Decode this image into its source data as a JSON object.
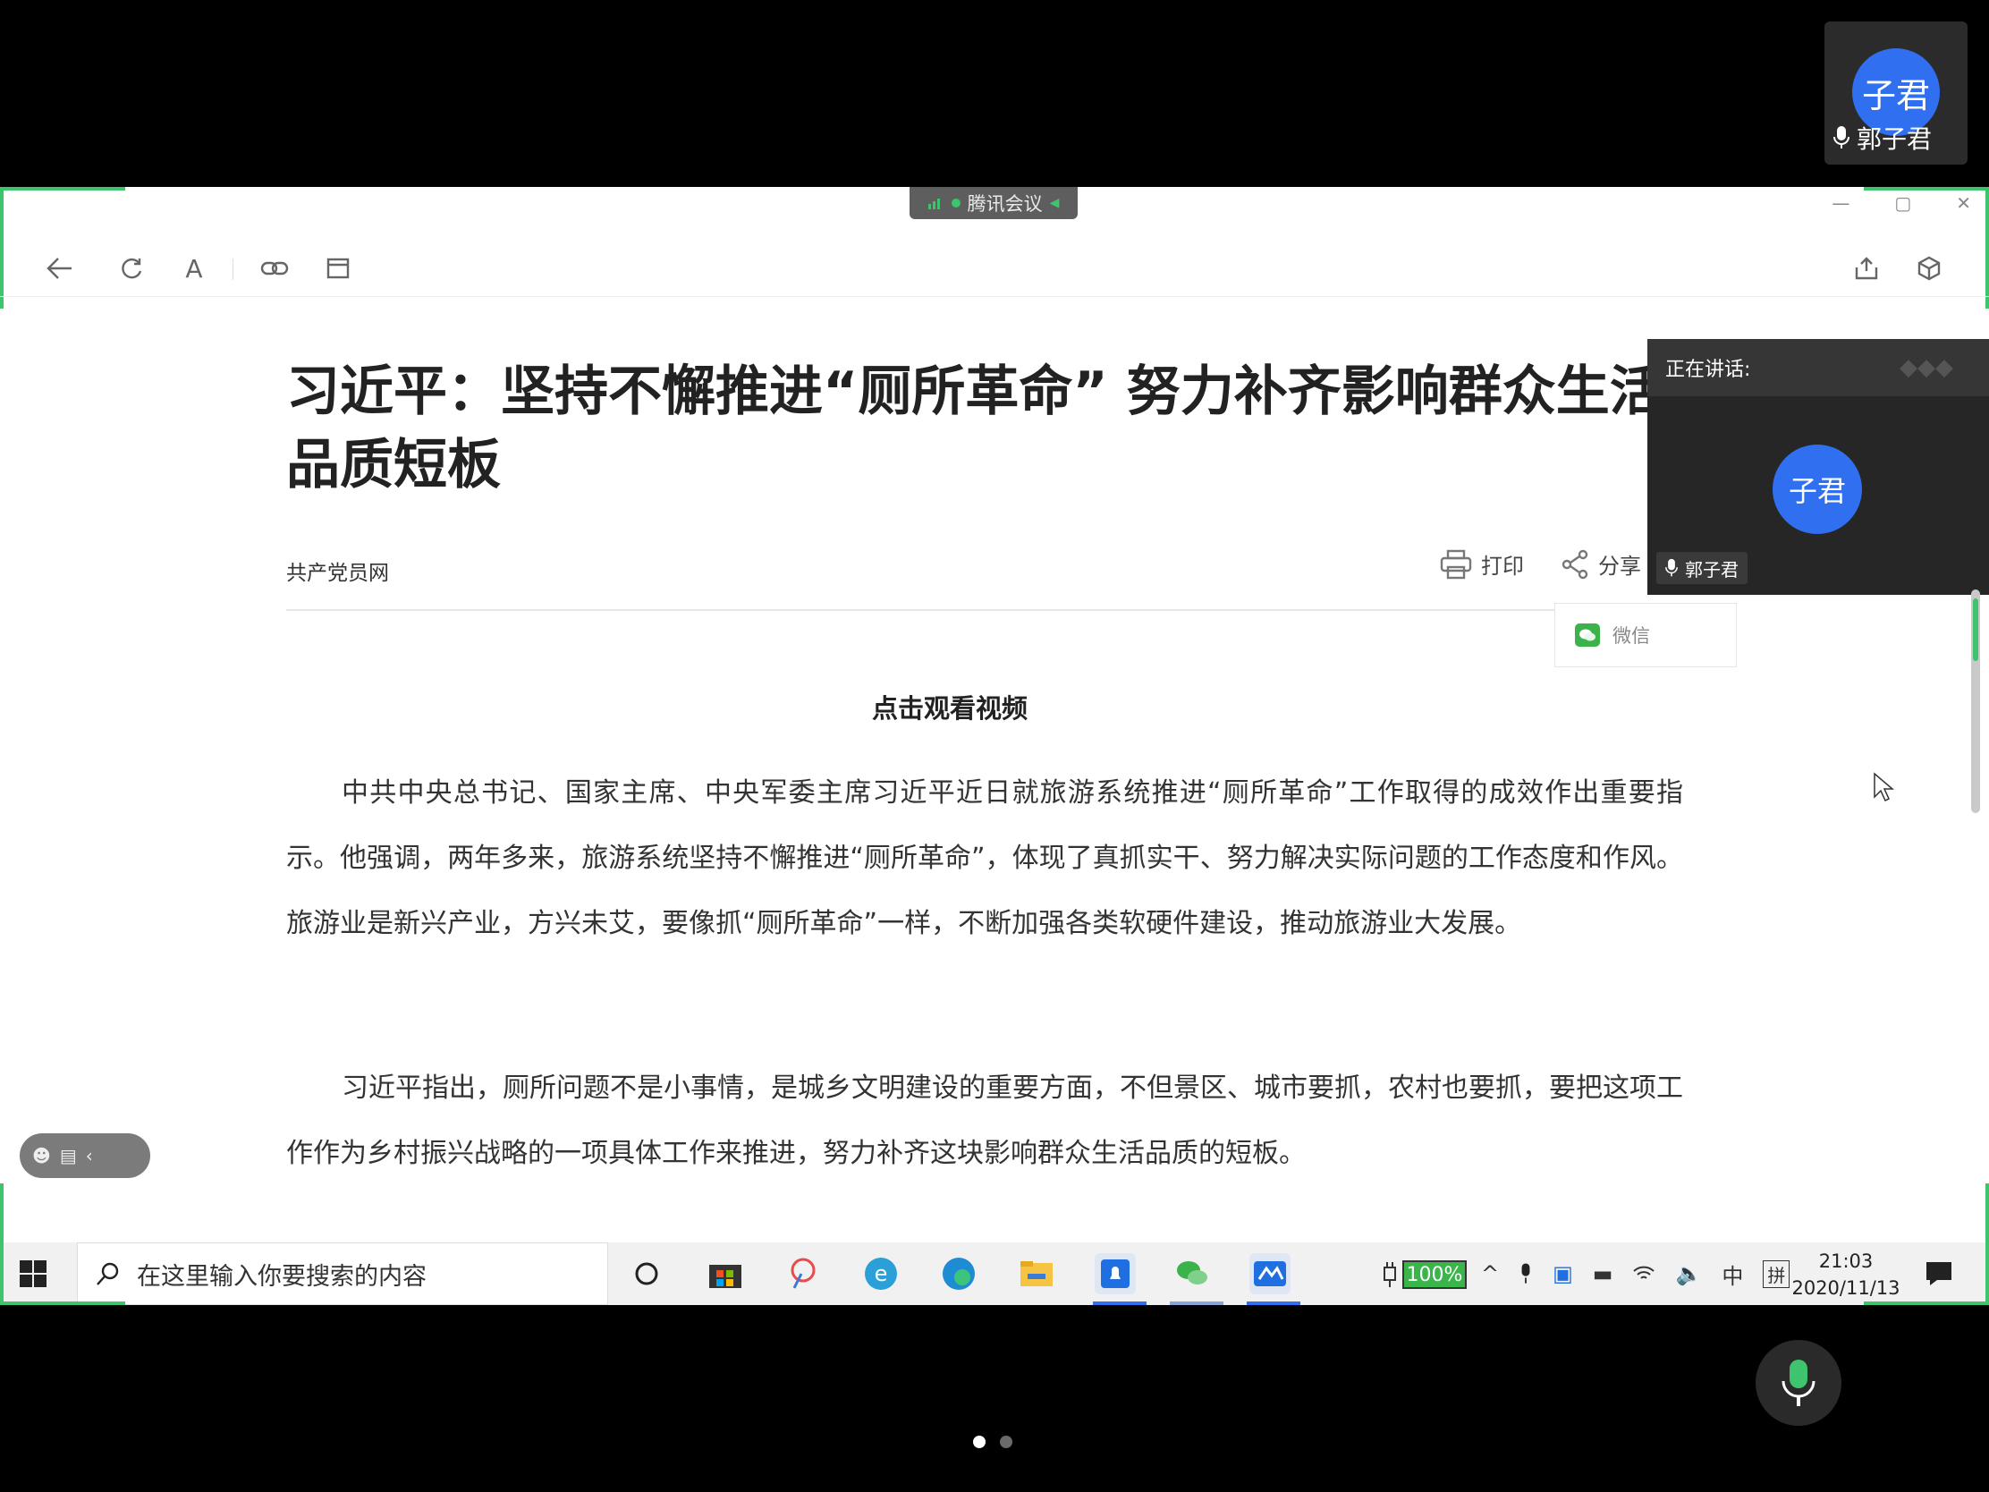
{
  "self_view": {
    "avatar_text": "子君",
    "name": "郭子君",
    "icon": "mic-icon"
  },
  "meeting": {
    "app_label": "腾讯会议"
  },
  "window_controls": [
    "—",
    "▢",
    "✕"
  ],
  "toolbar": {
    "left_icons": [
      "back-arrow-icon",
      "refresh-icon",
      "font-icon",
      "link-icon",
      "browser-window-icon"
    ],
    "right_icons": [
      "share-out-icon",
      "cube-icon"
    ],
    "font_icon_text": "A"
  },
  "article": {
    "title": "习近平：坚持不懈推进“厕所革命” 努力补齐影响群众生活品质短板",
    "source": "共产党员网",
    "print_label": "打印",
    "share_label": "分享",
    "share_popup": {
      "wechat_label": "微信"
    },
    "video_title": "点击观看视频",
    "paragraphs": [
      "中共中央总书记、国家主席、中央军委主席习近平近日就旅游系统推进“厕所革命”工作取得的成效作出重要指示。他强调，两年多来，旅游系统坚持不懈推进“厕所革命”，体现了真抓实干、努力解决实际问题的工作态度和作风。旅游业是新兴产业，方兴未艾，要像抓“厕所革命”一样，不断加强各类软硬件建设，推动旅游业大发展。",
      "习近平指出，厕所问题不是小事情，是城乡文明建设的重要方面，不但景区、城市要抓，农村也要抓，要把这项工作作为乡村振兴战略的一项具体工作来推进，努力补齐这块影响群众生活品质的短板。"
    ]
  },
  "speaking_panel": {
    "header": "正在讲话:",
    "avatar_text": "子君",
    "name": "郭子君"
  },
  "taskbar": {
    "search_placeholder": "在这里输入你要搜索的内容",
    "battery": "100%",
    "ime_1": "中",
    "ime_2": "拼",
    "time": "21:03",
    "date": "2020/11/13",
    "apps": [
      "cortana-icon",
      "store-icon",
      "paint-icon",
      "ie-icon",
      "edge-icon",
      "file-explorer-icon",
      "notification-app-icon",
      "wechat-icon",
      "tencent-meeting-icon"
    ]
  },
  "pager": {
    "pages": 2,
    "active": 1
  }
}
